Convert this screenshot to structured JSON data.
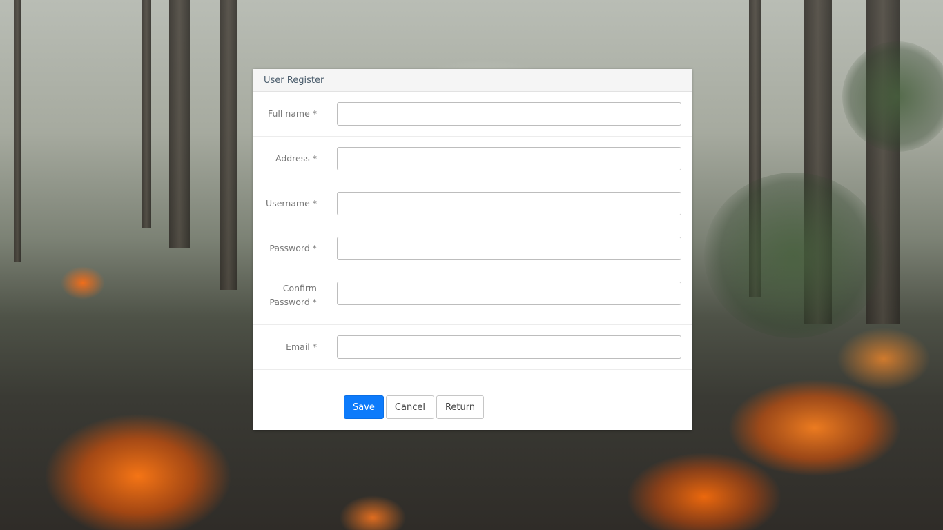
{
  "modal": {
    "title": "User Register",
    "fields": [
      {
        "label": "Full name *",
        "value": ""
      },
      {
        "label": "Address *",
        "value": ""
      },
      {
        "label": "Username *",
        "value": ""
      },
      {
        "label": "Password *",
        "value": ""
      },
      {
        "label_line1": "Confirm",
        "label_line2": "Password *",
        "value": ""
      },
      {
        "label": "Email *",
        "value": ""
      }
    ],
    "buttons": {
      "save": "Save",
      "cancel": "Cancel",
      "return": "Return"
    }
  },
  "colors": {
    "primary_button": "#0d7bfb",
    "header_bg": "#f5f5f5"
  }
}
